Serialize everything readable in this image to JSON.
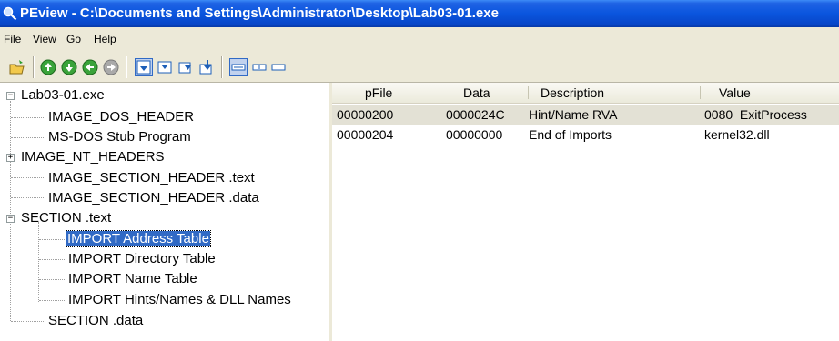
{
  "window": {
    "title": "PEview - C:\\Documents and Settings\\Administrator\\Desktop\\Lab03-01.exe"
  },
  "menu": [
    "File",
    "View",
    "Go",
    "Help"
  ],
  "toolbar": {
    "buttons": [
      "open-icon",
      "nav-first-icon",
      "nav-next-icon",
      "nav-back-icon",
      "nav-forward-icon",
      "view-top-icon",
      "view-down-icon",
      "view-next-icon",
      "view-prev-icon",
      "view-bytes-icon",
      "view-words-icon",
      "view-dwords-icon"
    ]
  },
  "tree": {
    "root": "Lab03-01.exe",
    "items": [
      "IMAGE_DOS_HEADER",
      "MS-DOS Stub Program",
      "IMAGE_NT_HEADERS",
      "IMAGE_SECTION_HEADER .text",
      "IMAGE_SECTION_HEADER .data",
      "SECTION .text",
      "IMPORT Address Table",
      "IMPORT Directory Table",
      "IMPORT Name Table",
      "IMPORT Hints/Names & DLL Names",
      "SECTION .data"
    ],
    "selected": "IMPORT Address Table"
  },
  "list": {
    "columns": [
      "pFile",
      "Data",
      "Description",
      "Value"
    ],
    "rows": [
      {
        "pfile": "00000200",
        "data": "0000024C",
        "description": "Hint/Name RVA",
        "value": "0080  ExitProcess"
      },
      {
        "pfile": "00000204",
        "data": "00000000",
        "description": "End of Imports",
        "value": "kernel32.dll"
      }
    ]
  },
  "colors": {
    "titlebar": "#0a55de",
    "selection": "#316ac5",
    "chrome": "#ece9d8"
  }
}
